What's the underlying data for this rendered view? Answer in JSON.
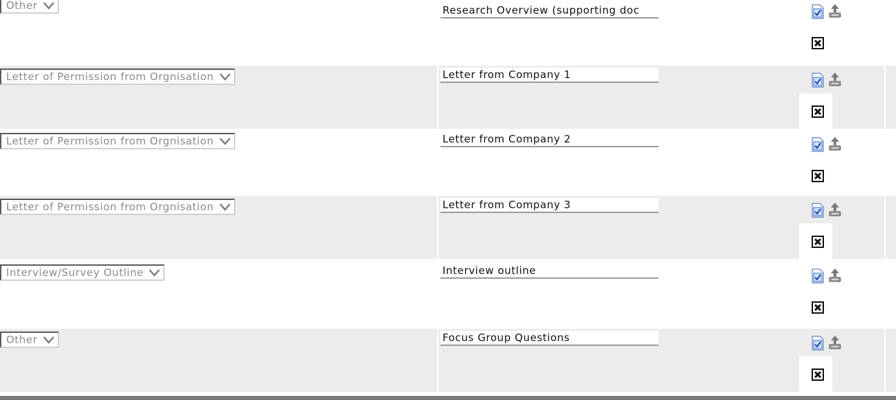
{
  "rows": [
    {
      "type": "Other",
      "description": "Research Overview (supporting doc",
      "actions": {
        "edit": "edit-icon",
        "upload": "upload-icon",
        "delete": "delete-icon"
      }
    },
    {
      "type": "Letter of Permission from Orgnisation",
      "description": "Letter from Company 1",
      "actions": {
        "edit": "edit-icon",
        "upload": "upload-icon",
        "delete": "delete-icon"
      }
    },
    {
      "type": "Letter of Permission from Orgnisation",
      "description": "Letter from Company 2",
      "actions": {
        "edit": "edit-icon",
        "upload": "upload-icon",
        "delete": "delete-icon"
      }
    },
    {
      "type": "Letter of Permission from Orgnisation",
      "description": "Letter from Company 3",
      "actions": {
        "edit": "edit-icon",
        "upload": "upload-icon",
        "delete": "delete-icon"
      }
    },
    {
      "type": "Interview/Survey Outline",
      "description": "Interview outline",
      "actions": {
        "edit": "edit-icon",
        "upload": "upload-icon",
        "delete": "delete-icon"
      }
    },
    {
      "type": "Other",
      "description": "Focus Group Questions",
      "actions": {
        "edit": "edit-icon",
        "upload": "upload-icon",
        "delete": "delete-icon"
      }
    }
  ],
  "colors": {
    "row_alt": "#ececec",
    "select_text": "#8a8a8a",
    "edit_icon_blue": "#2f6fd6"
  }
}
